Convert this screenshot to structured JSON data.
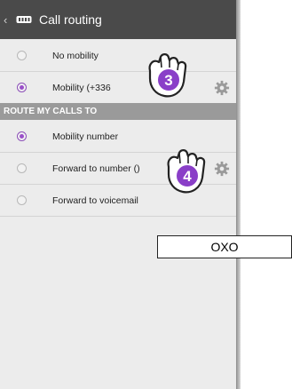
{
  "header": {
    "back_icon": "back-chevron-icon",
    "app_icon": "phone-mobility-icon",
    "title": "Call routing"
  },
  "mobility_options": [
    {
      "label": "No mobility",
      "checked": false,
      "has_settings": false
    },
    {
      "label": "Mobility (+336",
      "checked": true,
      "has_settings": true
    }
  ],
  "route_section": {
    "heading": "ROUTE MY CALLS TO",
    "options": [
      {
        "label": "Mobility number",
        "checked": true,
        "has_settings": false
      },
      {
        "label": "Forward to number ()",
        "checked": false,
        "has_settings": true
      },
      {
        "label": "Forward to voicemail",
        "checked": false,
        "has_settings": false
      }
    ]
  },
  "annotations": {
    "step_3": "3",
    "step_4": "4",
    "callout_label": "OXO"
  },
  "colors": {
    "action_bar": "#4a4a4a",
    "section_header": "#9a9a9a",
    "radio_accent": "#9a4fc9",
    "hand_badge": "#8a3fc8"
  }
}
